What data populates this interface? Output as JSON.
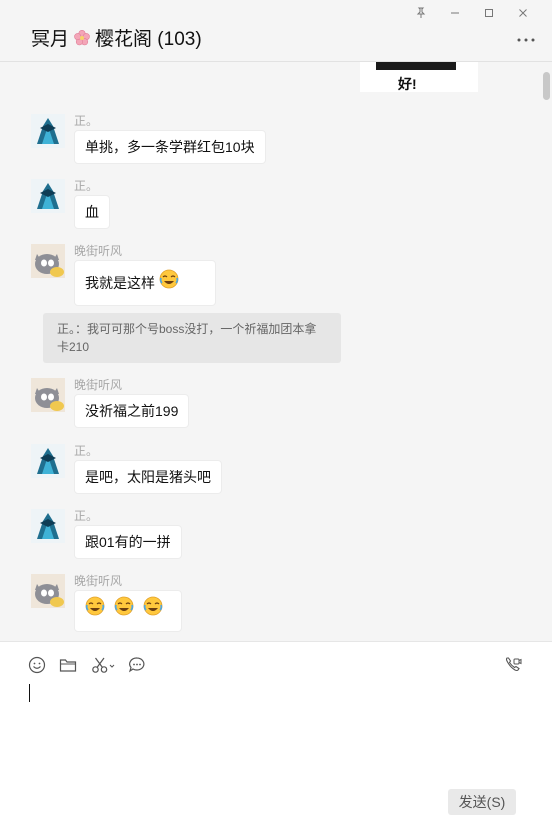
{
  "header": {
    "title_prefix": "冥月",
    "title_suffix": "樱花阁 (103)"
  },
  "sticker": {
    "text": "好!"
  },
  "messages": [
    {
      "sender": "正。",
      "text": "单挑，多一条学群红包10块"
    },
    {
      "sender": "正。",
      "text": "血"
    },
    {
      "sender": "晚街听风",
      "text": "我就是这样",
      "quote": "正。：我可可那个号boss没打，一个祈福加团本拿卡210"
    },
    {
      "sender": "晚街听风",
      "text": "没祈福之前199"
    },
    {
      "sender": "正。",
      "text": "是吧，太阳是猪头吧"
    },
    {
      "sender": "正。",
      "text": "跟01有的一拼"
    },
    {
      "sender": "晚街听风",
      "text": ""
    }
  ],
  "composer": {
    "send_label": "发送(S)"
  },
  "colors": {
    "background": "#f5f5f5",
    "bubble": "#ffffff",
    "quote": "#e6e6e6",
    "sender_name": "#a8a8a8"
  },
  "icons": [
    "pin-icon",
    "minimize-icon",
    "maximize-icon",
    "close-icon",
    "more-icon",
    "emoji-icon",
    "folder-icon",
    "scissors-icon",
    "chat-history-icon",
    "video-call-icon",
    "cherry-blossom-icon"
  ]
}
